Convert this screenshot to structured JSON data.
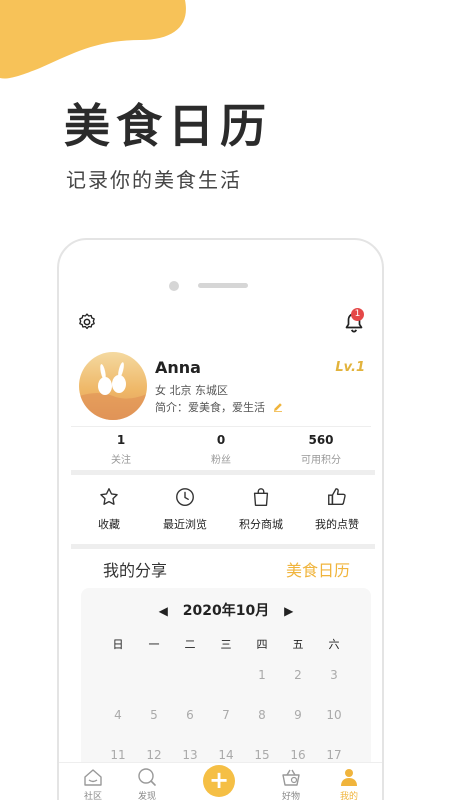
{
  "colors": {
    "accent": "#f0b43c",
    "badge": "#e54848",
    "text": "#222222"
  },
  "hero": {
    "title": "美食日历",
    "subtitle": "记录你的美食生活"
  },
  "header": {
    "settings_icon": "gear-icon",
    "notifications_icon": "bell-icon",
    "notification_count": "1"
  },
  "profile": {
    "name": "Anna",
    "level": "Lv.1",
    "info": "女  北京 东城区",
    "bio": "简介：爱美食，爱生活"
  },
  "stats": [
    {
      "value": "1",
      "label": "关注"
    },
    {
      "value": "0",
      "label": "粉丝"
    },
    {
      "value": "560",
      "label": "可用积分"
    }
  ],
  "actions": [
    {
      "label": "收藏",
      "icon": "star-icon"
    },
    {
      "label": "最近浏览",
      "icon": "clock-icon"
    },
    {
      "label": "积分商城",
      "icon": "bag-icon"
    },
    {
      "label": "我的点赞",
      "icon": "thumbs-up-icon"
    }
  ],
  "share": {
    "title": "我的分享",
    "link": "美食日历"
  },
  "calendar": {
    "month": "2020年10月",
    "prev": "◀",
    "next": "▶",
    "weekdays": [
      "日",
      "一",
      "二",
      "三",
      "四",
      "五",
      "六"
    ],
    "rows": [
      [
        "",
        "",
        "",
        "",
        "1",
        "2",
        "3"
      ],
      [
        "4",
        "5",
        "6",
        "7",
        "8",
        "9",
        "10"
      ],
      [
        "11",
        "12",
        "13",
        "14",
        "15",
        "16",
        "17"
      ]
    ]
  },
  "tabs": [
    {
      "label": "社区",
      "icon": "community-icon"
    },
    {
      "label": "发现",
      "icon": "discover-icon"
    },
    {
      "label": "",
      "icon": "plus-icon"
    },
    {
      "label": "好物",
      "icon": "basket-icon"
    },
    {
      "label": "我的",
      "icon": "user-icon",
      "active": true
    }
  ]
}
